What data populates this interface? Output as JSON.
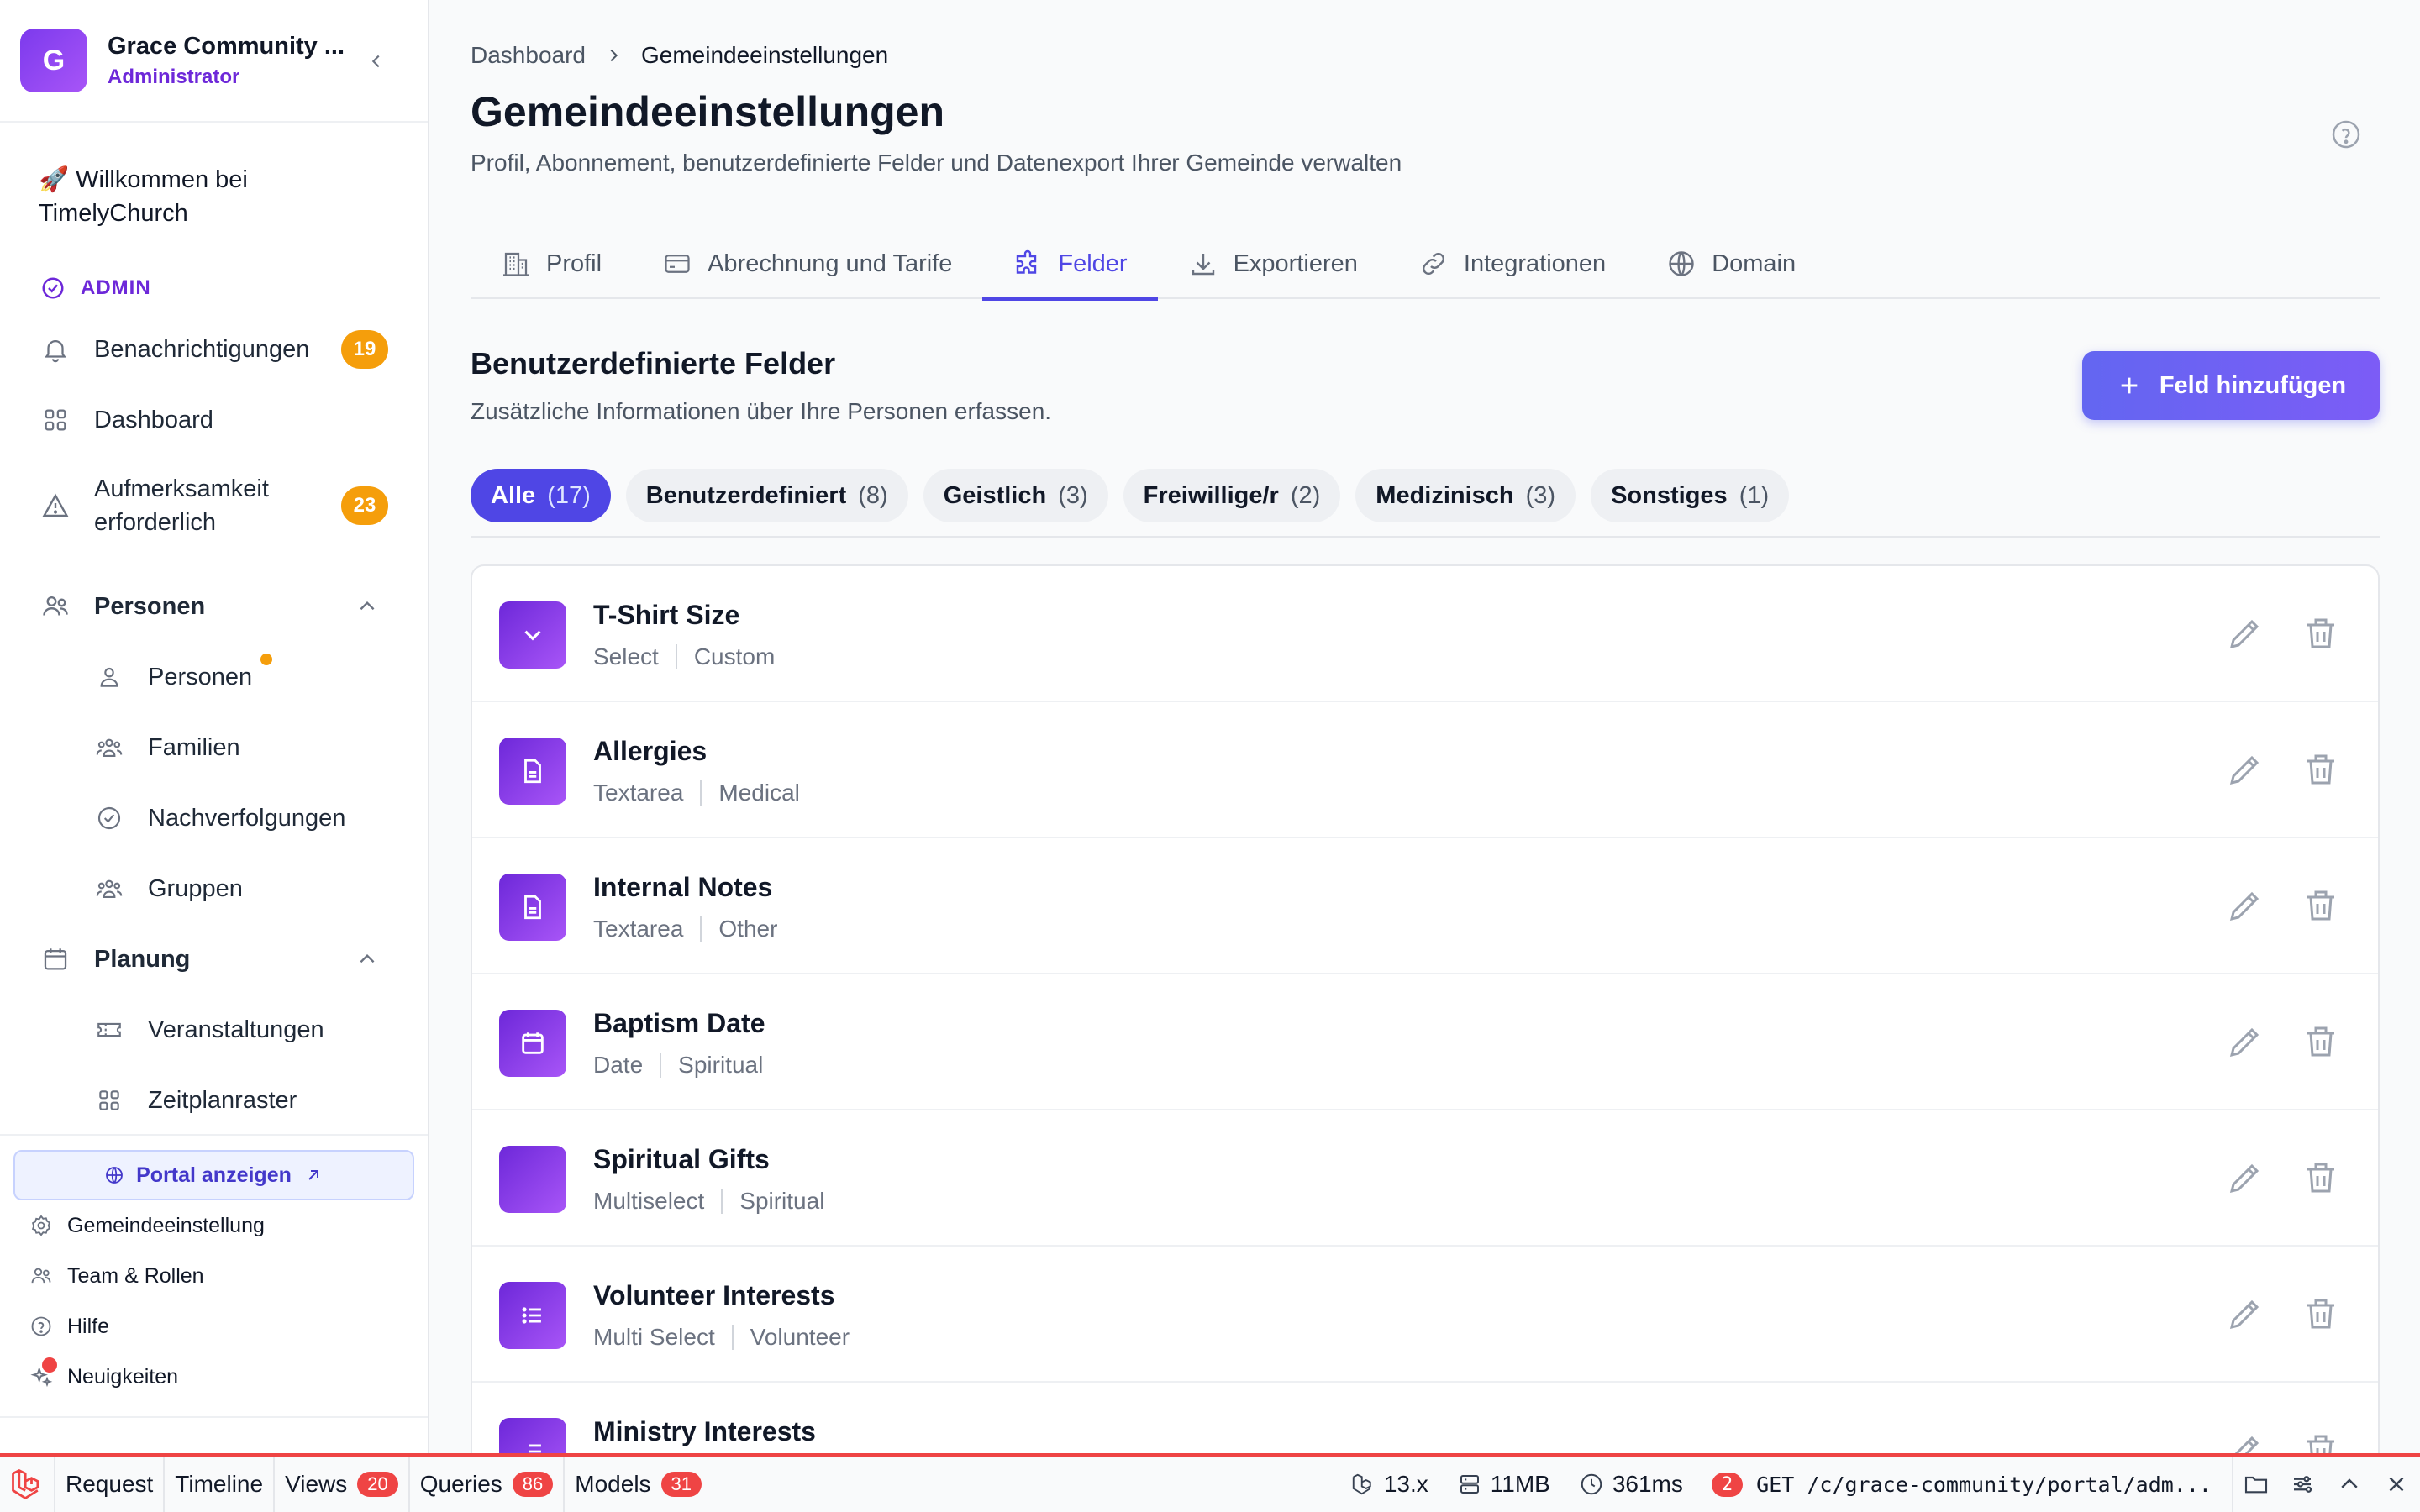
{
  "sidebar": {
    "org_initial": "G",
    "org_name": "Grace Community ...",
    "org_role": "Administrator",
    "welcome_emoji": "🚀",
    "welcome": "Willkommen bei TimelyChurch",
    "section_label": "ADMIN",
    "items": [
      {
        "label": "Benachrichtigungen",
        "badge": "19",
        "icon": "bell-icon"
      },
      {
        "label": "Dashboard",
        "icon": "grid-icon"
      },
      {
        "label": "Aufmerksamkeit erforderlich",
        "badge": "23",
        "icon": "warning-icon"
      }
    ],
    "groups": [
      {
        "label": "Personen",
        "icon": "users-icon",
        "children": [
          {
            "label": "Personen",
            "icon": "user-icon",
            "dot": true
          },
          {
            "label": "Familien",
            "icon": "family-icon"
          },
          {
            "label": "Nachverfolgungen",
            "icon": "check-circle-icon"
          },
          {
            "label": "Gruppen",
            "icon": "group-icon"
          }
        ]
      },
      {
        "label": "Planung",
        "icon": "calendar-icon",
        "children": [
          {
            "label": "Veranstaltungen",
            "icon": "ticket-icon"
          },
          {
            "label": "Zeitplanraster",
            "icon": "grid-icon"
          }
        ]
      }
    ],
    "portal_button": "Portal anzeigen",
    "footer": [
      {
        "label": "Gemeindeeinstellung",
        "icon": "gear-icon"
      },
      {
        "label": "Team & Rollen",
        "icon": "users-icon"
      },
      {
        "label": "Hilfe",
        "icon": "help-icon"
      },
      {
        "label": "Neuigkeiten",
        "icon": "sparkles-icon"
      }
    ]
  },
  "breadcrumb": {
    "root": "Dashboard",
    "current": "Gemeindeeinstellungen"
  },
  "page": {
    "title": "Gemeindeeinstellungen",
    "subtitle": "Profil, Abonnement, benutzerdefinierte Felder und Datenexport Ihrer Gemeinde verwalten"
  },
  "tabs": [
    {
      "label": "Profil",
      "icon": "building-icon"
    },
    {
      "label": "Abrechnung und Tarife",
      "icon": "credit-card-icon"
    },
    {
      "label": "Felder",
      "icon": "puzzle-icon",
      "active": true
    },
    {
      "label": "Exportieren",
      "icon": "download-icon"
    },
    {
      "label": "Integrationen",
      "icon": "link-icon"
    },
    {
      "label": "Domain",
      "icon": "globe-icon"
    }
  ],
  "section": {
    "title": "Benutzerdefinierte Felder",
    "subtitle": "Zusätzliche Informationen über Ihre Personen erfassen.",
    "add_button": "Feld hinzufügen"
  },
  "filters": [
    {
      "label": "Alle",
      "count": "(17)",
      "active": true
    },
    {
      "label": "Benutzerdefiniert",
      "count": "(8)"
    },
    {
      "label": "Geistlich",
      "count": "(3)"
    },
    {
      "label": "Freiwillige/r",
      "count": "(2)"
    },
    {
      "label": "Medizinisch",
      "count": "(3)"
    },
    {
      "label": "Sonstiges",
      "count": "(1)"
    }
  ],
  "fields": [
    {
      "name": "T-Shirt Size",
      "type": "Select",
      "category": "Custom",
      "icon": "chevron-down-icon"
    },
    {
      "name": "Allergies",
      "type": "Textarea",
      "category": "Medical",
      "icon": "document-icon"
    },
    {
      "name": "Internal Notes",
      "type": "Textarea",
      "category": "Other",
      "icon": "document-icon"
    },
    {
      "name": "Baptism Date",
      "type": "Date",
      "category": "Spiritual",
      "icon": "calendar-icon"
    },
    {
      "name": "Spiritual Gifts",
      "type": "Multiselect",
      "category": "Spiritual",
      "icon": "none"
    },
    {
      "name": "Volunteer Interests",
      "type": "Multi Select",
      "category": "Volunteer",
      "icon": "list-icon"
    },
    {
      "name": "Ministry Interests",
      "type": "",
      "category": "",
      "icon": "list-icon"
    }
  ],
  "debugbar": {
    "tabs": [
      {
        "label": "Request"
      },
      {
        "label": "Timeline"
      },
      {
        "label": "Views",
        "badge": "20"
      },
      {
        "label": "Queries",
        "badge": "86"
      },
      {
        "label": "Models",
        "badge": "31"
      }
    ],
    "version": "13.x",
    "memory": "11MB",
    "time": "361ms",
    "request_count": "2",
    "request": "GET /c/grace-community/portal/adm..."
  },
  "colors": {
    "accent": "#4f46e5",
    "brand_purple": "#7c3aed",
    "badge_orange": "#f59e0b",
    "debug_red": "#ef4444"
  }
}
